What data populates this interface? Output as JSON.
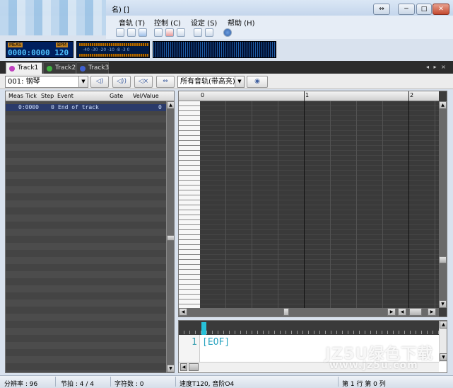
{
  "window": {
    "title": "名) []",
    "controls": {
      "minimize": "─",
      "maximize": "□",
      "close": "✕",
      "restore": "⇔"
    }
  },
  "menu": [
    "音轨 (T)",
    "控制 (C)",
    "设定 (S)",
    "帮助 (H)"
  ],
  "toolbar_icons": [
    "play-pause-icon",
    "stop-icon",
    "forward-icon",
    "new-icon",
    "delete-icon",
    "open-icon",
    "save-icon",
    "print-icon",
    "info-icon"
  ],
  "display": {
    "pos_label_a": "MEAS",
    "pos_label_b": "BPM",
    "position": "0000:0000 120",
    "meter_scale": "-40   -30   -20 -10 -8 -3 0"
  },
  "tabs": [
    {
      "label": "Track1",
      "color": "#c040c0",
      "active": true
    },
    {
      "label": "Track2",
      "color": "#40b040",
      "active": false
    },
    {
      "label": "Track3",
      "color": "#4060d0",
      "active": false
    }
  ],
  "tab_nav": "◂ ▸ ×",
  "instrument": "001: 钢琴",
  "track_filter": "所有音轨(带高亮)",
  "event_list": {
    "headers": [
      "Meas",
      "Tick",
      "Step",
      "Event",
      "Gate",
      "Vel/Value"
    ],
    "rows": [
      {
        "pos": "0:0000",
        "step": "0",
        "event": "End of track",
        "value": "0"
      }
    ]
  },
  "ruler_marks": [
    "0",
    "1",
    "2"
  ],
  "mml": {
    "line": "1",
    "text": "[EOF]"
  },
  "watermark": {
    "line1": "JZ5U绿色下载",
    "line2": "www.jz5u.com"
  },
  "status": {
    "resolution": "分辨率 : 96",
    "beat": "节拍 : 4 / 4",
    "chars": "字符数 : 0",
    "tempo": "速度T120, 音阶O4",
    "cursor": "第 1 行  第 0 列"
  }
}
